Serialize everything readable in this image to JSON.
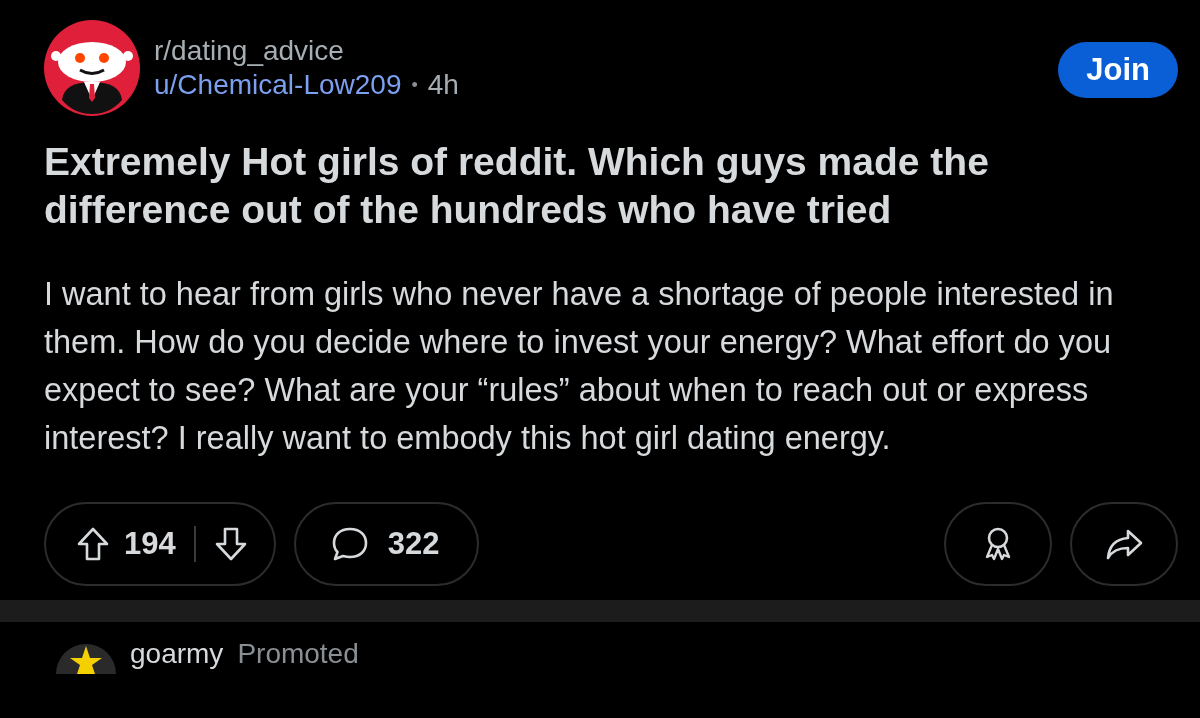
{
  "post": {
    "subreddit": "r/dating_advice",
    "author": "u/Chemical-Low209",
    "separator": "•",
    "age": "4h",
    "join_button": "Join",
    "title": "Extremely Hot girls of reddit. Which guys made the difference out of the hundreds who have tried",
    "body": "I want to hear from girls who never have a shortage of people interested in them. How do you decide where to invest your energy? What effort do you expect to see? What are your “rules” about when to reach out or express interest? I really want to embody this hot girl dating energy.",
    "votes": "194",
    "comments": "322"
  },
  "next_post": {
    "author": "goarmy",
    "label": "Promoted"
  }
}
